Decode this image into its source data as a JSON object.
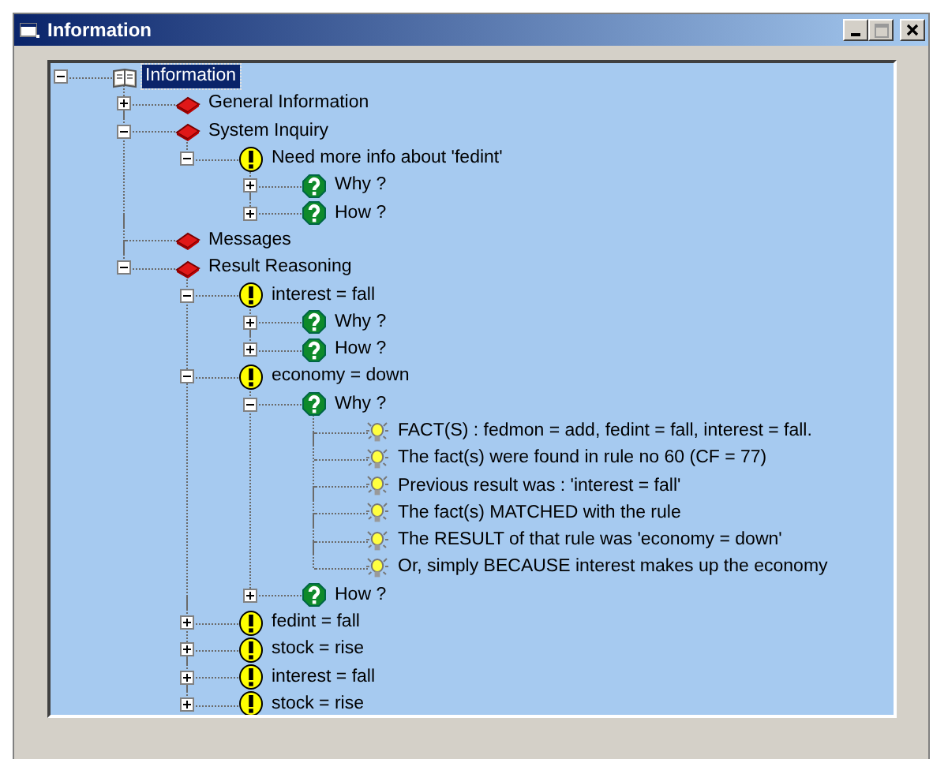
{
  "window": {
    "title": "Information"
  },
  "tree": [
    {
      "label": "Information",
      "kind": "book",
      "expanded": true,
      "selected": true,
      "children": [
        {
          "label": "General Information",
          "kind": "topic",
          "expanded": false,
          "selected": false
        },
        {
          "label": "System Inquiry",
          "kind": "topic",
          "expanded": true,
          "selected": false,
          "children": [
            {
              "label": "Need more info about 'fedint'",
              "kind": "fact",
              "expanded": true,
              "selected": false,
              "children": [
                {
                  "label": "Why ?",
                  "kind": "question",
                  "expanded": false,
                  "selected": false
                },
                {
                  "label": "How ?",
                  "kind": "question",
                  "expanded": false,
                  "selected": false
                }
              ]
            }
          ]
        },
        {
          "label": "Messages",
          "kind": "topic",
          "selected": false
        },
        {
          "label": "Result Reasoning",
          "kind": "topic",
          "expanded": true,
          "selected": false,
          "children": [
            {
              "label": "interest = fall",
              "kind": "fact",
              "expanded": true,
              "selected": false,
              "children": [
                {
                  "label": "Why ?",
                  "kind": "question",
                  "expanded": false,
                  "selected": false
                },
                {
                  "label": "How ?",
                  "kind": "question",
                  "expanded": false,
                  "selected": false
                }
              ]
            },
            {
              "label": "economy = down",
              "kind": "fact",
              "expanded": true,
              "selected": false,
              "children": [
                {
                  "label": "Why ?",
                  "kind": "question",
                  "expanded": true,
                  "selected": false,
                  "children": [
                    {
                      "label": "FACT(S) : fedmon = add, fedint = fall, interest = fall.",
                      "kind": "reason",
                      "selected": false
                    },
                    {
                      "label": "The fact(s) were found in rule no 60 (CF = 77)",
                      "kind": "reason",
                      "selected": false
                    },
                    {
                      "label": "Previous result was : 'interest = fall'",
                      "kind": "reason",
                      "selected": false
                    },
                    {
                      "label": "The fact(s) MATCHED with the rule",
                      "kind": "reason",
                      "selected": false
                    },
                    {
                      "label": "The RESULT of that rule was 'economy = down'",
                      "kind": "reason",
                      "selected": false
                    },
                    {
                      "label": "Or, simply BECAUSE interest makes up the economy",
                      "kind": "reason",
                      "selected": false
                    }
                  ]
                },
                {
                  "label": "How ?",
                  "kind": "question",
                  "expanded": false,
                  "selected": false
                }
              ]
            },
            {
              "label": "fedint = fall",
              "kind": "fact",
              "expanded": false,
              "selected": false
            },
            {
              "label": "stock = rise",
              "kind": "fact",
              "expanded": false,
              "selected": false
            },
            {
              "label": "interest = fall",
              "kind": "fact",
              "expanded": false,
              "selected": false
            },
            {
              "label": "stock = rise",
              "kind": "fact",
              "expanded": false,
              "selected": false
            }
          ]
        }
      ]
    }
  ]
}
